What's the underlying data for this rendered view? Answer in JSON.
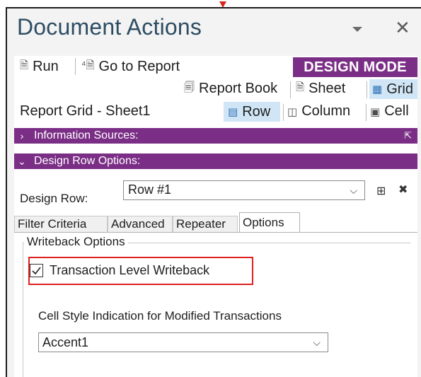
{
  "panel": {
    "title": "Document Actions"
  },
  "toolbar": {
    "run_label": "Run",
    "goto_report_label": "Go to Report",
    "mode_badge": "DESIGN MODE"
  },
  "view_tabs": {
    "report_book": "Report Book",
    "sheet": "Sheet",
    "grid": "Grid",
    "selected": "Grid"
  },
  "context": {
    "title": "Report Grid - Sheet1",
    "row": "Row",
    "column": "Column",
    "cell": "Cell",
    "selected": "Row"
  },
  "sections": {
    "information_sources": "Information Sources:",
    "design_row_options": "Design Row Options:"
  },
  "design_row": {
    "label": "Design Row:",
    "value": "Row #1"
  },
  "tabs": [
    {
      "label": "Filter Criteria",
      "active": false
    },
    {
      "label": "Advanced",
      "active": false
    },
    {
      "label": "Repeater",
      "active": false
    },
    {
      "label": "Options",
      "active": true
    }
  ],
  "options": {
    "group_title": "Writeback Options",
    "transaction_level_writeback": {
      "label": "Transaction Level Writeback",
      "checked": true
    },
    "cell_style_label": "Cell Style Indication for Modified Transactions",
    "cell_style_value": "Accent1"
  },
  "colors": {
    "accent": "#7b2e86",
    "title_text": "#2d4d63",
    "highlight_box": "#e02020",
    "selected_bg": "#d0e6f7"
  },
  "icons": [
    "run-icon",
    "report-icon",
    "report-book-icon",
    "sheet-icon",
    "grid-icon",
    "row-icon",
    "column-icon",
    "cell-icon",
    "chevron-right-icon",
    "chevron-down-icon",
    "pin-icon",
    "add-row-icon",
    "delete-row-icon",
    "close-icon",
    "dropdown-icon",
    "checkmark-icon"
  ]
}
